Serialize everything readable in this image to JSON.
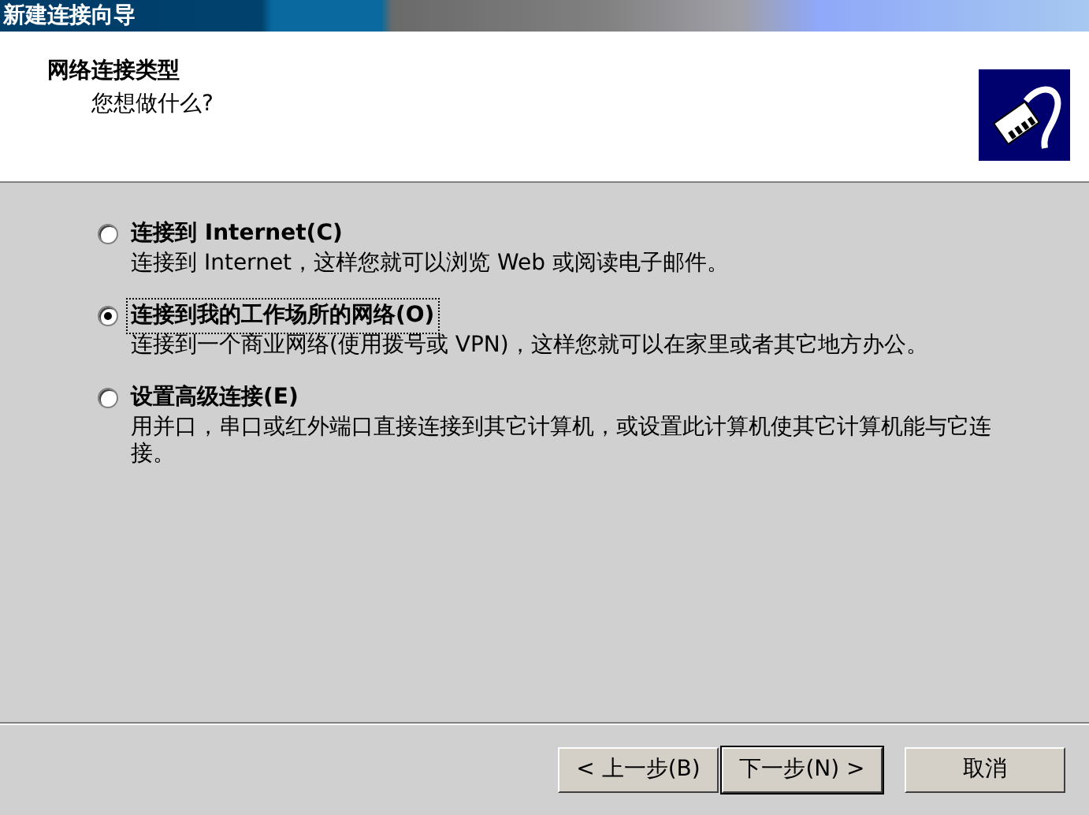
{
  "window": {
    "title": "新建连接向导"
  },
  "header": {
    "title": "网络连接类型",
    "subtitle": "您想做什么?"
  },
  "options": [
    {
      "label": "连接到 Internet(C)",
      "description": "连接到 Internet，这样您就可以浏览 Web 或阅读电子邮件。",
      "selected": false
    },
    {
      "label": "连接到我的工作场所的网络(O)",
      "description": "连接到一个商业网络(使用拨号或 VPN)，这样您就可以在家里或者其它地方办公。",
      "selected": true
    },
    {
      "label": "设置高级连接(E)",
      "description": "用并口，串口或红外端口直接连接到其它计算机，或设置此计算机使其它计算机能与它连接。",
      "selected": false
    }
  ],
  "buttons": [
    {
      "label": "< 上一步(B)",
      "default": false
    },
    {
      "label": "下一步(N) >",
      "default": true
    },
    {
      "label": "取消",
      "default": false
    }
  ]
}
